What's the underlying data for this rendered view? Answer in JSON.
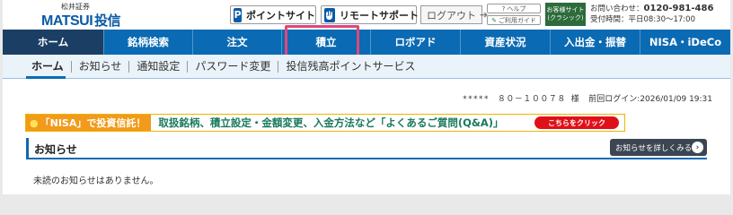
{
  "header": {
    "logo_top": "松井証券",
    "logo_main": "MATSUI",
    "logo_fund": "投信",
    "point_site_icon": "P",
    "point_site_label": "ポイントサイト",
    "remote_support_label": "リモートサポート",
    "logout_label": "ログアウト",
    "help_label": "ヘルプ",
    "guide_label": "ご利用ガイド",
    "classic_line1": "お客様サイト",
    "classic_line2": "(クラシック)",
    "contact_label": "お問い合わせ：",
    "contact_phone": "0120-981-486",
    "hours": "受付時間：平日08:30～17:00"
  },
  "mainnav": {
    "items": [
      {
        "label": "ホーム"
      },
      {
        "label": "銘柄検索"
      },
      {
        "label": "注文"
      },
      {
        "label": "積立"
      },
      {
        "label": "ロボアド"
      },
      {
        "label": "資産状況"
      },
      {
        "label": "入出金・振替"
      },
      {
        "label": "NISA・iDeCo"
      }
    ]
  },
  "subnav": {
    "items": [
      {
        "label": "ホーム"
      },
      {
        "label": "お知らせ"
      },
      {
        "label": "通知設定"
      },
      {
        "label": "パスワード変更"
      },
      {
        "label": "投信残高ポイントサービス"
      }
    ]
  },
  "account": {
    "masked_id": "*****　８０－１００７８ 様",
    "last_login": "前回ログイン:2026/01/09 19:31"
  },
  "banner": {
    "left_text": "「NISA」で投資信託！",
    "main_text": "取扱銘柄、積立設定・金額変更、入金方法など「よくあるご質問(Q&A)」",
    "button_label": "こちらをクリック"
  },
  "notice": {
    "title": "お知らせ",
    "more_label": "お知らせを詳しくみる",
    "empty_text": "未読のお知らせはありません。"
  },
  "colors": {
    "nav_blue": "#0a6ab3",
    "nav_active": "#1b3f64",
    "highlight": "#e0477a",
    "banner_orange": "#f29a1a",
    "banner_red": "#e0101a",
    "classic_green": "#2d6b3a"
  }
}
